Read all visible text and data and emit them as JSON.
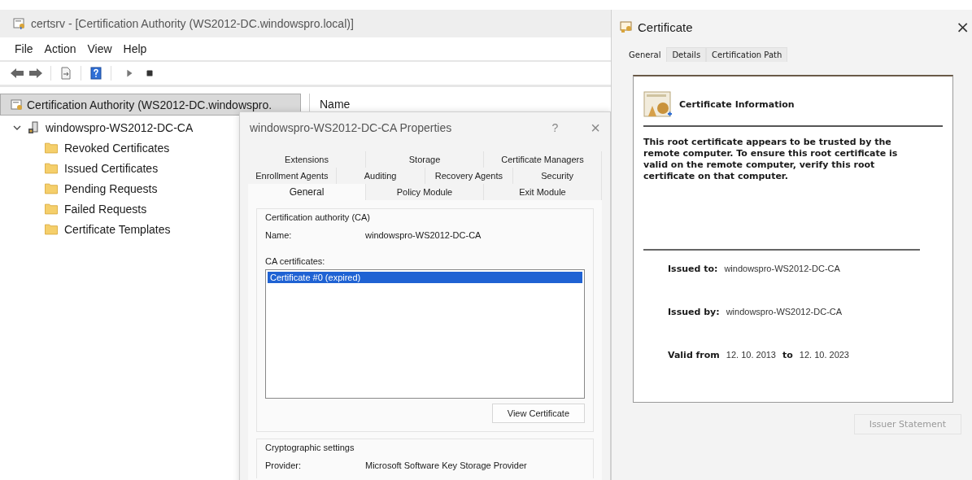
{
  "main_window": {
    "title": "certsrv - [Certification Authority (WS2012-DC.windowspro.local)]",
    "menu": [
      "File",
      "Action",
      "View",
      "Help"
    ],
    "tree": {
      "header": "Certification Authority (WS2012-DC.windowspro.",
      "root": {
        "label": "windowspro-WS2012-DC-CA",
        "expanded": true,
        "children": [
          {
            "label": "Revoked Certificates"
          },
          {
            "label": "Issued Certificates"
          },
          {
            "label": "Pending Requests"
          },
          {
            "label": "Failed Requests"
          },
          {
            "label": "Certificate Templates"
          }
        ]
      }
    },
    "list_header": "Name"
  },
  "properties_dialog": {
    "title": "windowspro-WS2012-DC-CA Properties",
    "help": "?",
    "close": "×",
    "tab_rows": [
      [
        {
          "label": "Extensions",
          "selected": false
        },
        {
          "label": "Storage",
          "selected": false
        },
        {
          "label": "Certificate Managers",
          "selected": false
        }
      ],
      [
        {
          "label": "Enrollment Agents",
          "selected": false
        },
        {
          "label": "Auditing",
          "selected": false
        },
        {
          "label": "Recovery Agents",
          "selected": false
        },
        {
          "label": "Security",
          "selected": false
        }
      ],
      [
        {
          "label": "General",
          "selected": true
        },
        {
          "label": "Policy Module",
          "selected": false
        },
        {
          "label": "Exit Module",
          "selected": false
        }
      ]
    ],
    "ca_group": {
      "title": "Certification authority (CA)",
      "name_label": "Name:",
      "name_value": "windowspro-WS2012-DC-CA",
      "certs_label": "CA certificates:",
      "certificates": [
        {
          "label": "Certificate #0 (expired)",
          "selected": true
        }
      ],
      "view_button": "View Certificate"
    },
    "crypto_group": {
      "title": "Cryptographic settings",
      "provider_label": "Provider:",
      "provider_value": "Microsoft Software Key Storage Provider"
    }
  },
  "certificate_dialog": {
    "title": "Certificate",
    "close": "×",
    "tabs": [
      {
        "label": "General",
        "selected": true
      },
      {
        "label": "Details",
        "selected": false
      },
      {
        "label": "Certification Path",
        "selected": false
      }
    ],
    "heading": "Certificate Information",
    "message": "This root certificate appears to be trusted by the remote computer. To ensure this root certificate is valid on the remote computer, verify this root certificate on that computer.",
    "issued_to_label": "Issued to:",
    "issued_to": "windowspro-WS2012-DC-CA",
    "issued_by_label": "Issued by:",
    "issued_by": "windowspro-WS2012-DC-CA",
    "valid_from_label": "Valid from",
    "valid_from": "12. 10. 2013",
    "valid_to_label": "to",
    "valid_to": "12. 10. 2023",
    "issuer_button": {
      "label": "Issuer Statement",
      "disabled": true
    }
  }
}
